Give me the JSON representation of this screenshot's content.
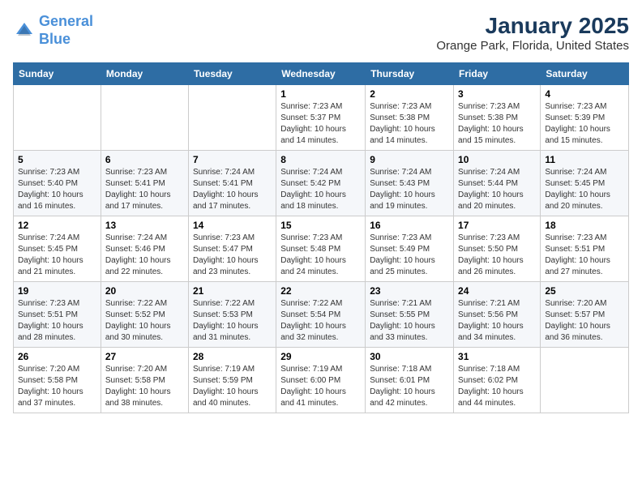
{
  "header": {
    "logo_line1": "General",
    "logo_line2": "Blue",
    "title": "January 2025",
    "subtitle": "Orange Park, Florida, United States"
  },
  "days_of_week": [
    "Sunday",
    "Monday",
    "Tuesday",
    "Wednesday",
    "Thursday",
    "Friday",
    "Saturday"
  ],
  "weeks": [
    [
      {
        "day": "",
        "info": ""
      },
      {
        "day": "",
        "info": ""
      },
      {
        "day": "",
        "info": ""
      },
      {
        "day": "1",
        "info": "Sunrise: 7:23 AM\nSunset: 5:37 PM\nDaylight: 10 hours and 14 minutes."
      },
      {
        "day": "2",
        "info": "Sunrise: 7:23 AM\nSunset: 5:38 PM\nDaylight: 10 hours and 14 minutes."
      },
      {
        "day": "3",
        "info": "Sunrise: 7:23 AM\nSunset: 5:38 PM\nDaylight: 10 hours and 15 minutes."
      },
      {
        "day": "4",
        "info": "Sunrise: 7:23 AM\nSunset: 5:39 PM\nDaylight: 10 hours and 15 minutes."
      }
    ],
    [
      {
        "day": "5",
        "info": "Sunrise: 7:23 AM\nSunset: 5:40 PM\nDaylight: 10 hours and 16 minutes."
      },
      {
        "day": "6",
        "info": "Sunrise: 7:23 AM\nSunset: 5:41 PM\nDaylight: 10 hours and 17 minutes."
      },
      {
        "day": "7",
        "info": "Sunrise: 7:24 AM\nSunset: 5:41 PM\nDaylight: 10 hours and 17 minutes."
      },
      {
        "day": "8",
        "info": "Sunrise: 7:24 AM\nSunset: 5:42 PM\nDaylight: 10 hours and 18 minutes."
      },
      {
        "day": "9",
        "info": "Sunrise: 7:24 AM\nSunset: 5:43 PM\nDaylight: 10 hours and 19 minutes."
      },
      {
        "day": "10",
        "info": "Sunrise: 7:24 AM\nSunset: 5:44 PM\nDaylight: 10 hours and 20 minutes."
      },
      {
        "day": "11",
        "info": "Sunrise: 7:24 AM\nSunset: 5:45 PM\nDaylight: 10 hours and 20 minutes."
      }
    ],
    [
      {
        "day": "12",
        "info": "Sunrise: 7:24 AM\nSunset: 5:45 PM\nDaylight: 10 hours and 21 minutes."
      },
      {
        "day": "13",
        "info": "Sunrise: 7:24 AM\nSunset: 5:46 PM\nDaylight: 10 hours and 22 minutes."
      },
      {
        "day": "14",
        "info": "Sunrise: 7:23 AM\nSunset: 5:47 PM\nDaylight: 10 hours and 23 minutes."
      },
      {
        "day": "15",
        "info": "Sunrise: 7:23 AM\nSunset: 5:48 PM\nDaylight: 10 hours and 24 minutes."
      },
      {
        "day": "16",
        "info": "Sunrise: 7:23 AM\nSunset: 5:49 PM\nDaylight: 10 hours and 25 minutes."
      },
      {
        "day": "17",
        "info": "Sunrise: 7:23 AM\nSunset: 5:50 PM\nDaylight: 10 hours and 26 minutes."
      },
      {
        "day": "18",
        "info": "Sunrise: 7:23 AM\nSunset: 5:51 PM\nDaylight: 10 hours and 27 minutes."
      }
    ],
    [
      {
        "day": "19",
        "info": "Sunrise: 7:23 AM\nSunset: 5:51 PM\nDaylight: 10 hours and 28 minutes."
      },
      {
        "day": "20",
        "info": "Sunrise: 7:22 AM\nSunset: 5:52 PM\nDaylight: 10 hours and 30 minutes."
      },
      {
        "day": "21",
        "info": "Sunrise: 7:22 AM\nSunset: 5:53 PM\nDaylight: 10 hours and 31 minutes."
      },
      {
        "day": "22",
        "info": "Sunrise: 7:22 AM\nSunset: 5:54 PM\nDaylight: 10 hours and 32 minutes."
      },
      {
        "day": "23",
        "info": "Sunrise: 7:21 AM\nSunset: 5:55 PM\nDaylight: 10 hours and 33 minutes."
      },
      {
        "day": "24",
        "info": "Sunrise: 7:21 AM\nSunset: 5:56 PM\nDaylight: 10 hours and 34 minutes."
      },
      {
        "day": "25",
        "info": "Sunrise: 7:20 AM\nSunset: 5:57 PM\nDaylight: 10 hours and 36 minutes."
      }
    ],
    [
      {
        "day": "26",
        "info": "Sunrise: 7:20 AM\nSunset: 5:58 PM\nDaylight: 10 hours and 37 minutes."
      },
      {
        "day": "27",
        "info": "Sunrise: 7:20 AM\nSunset: 5:58 PM\nDaylight: 10 hours and 38 minutes."
      },
      {
        "day": "28",
        "info": "Sunrise: 7:19 AM\nSunset: 5:59 PM\nDaylight: 10 hours and 40 minutes."
      },
      {
        "day": "29",
        "info": "Sunrise: 7:19 AM\nSunset: 6:00 PM\nDaylight: 10 hours and 41 minutes."
      },
      {
        "day": "30",
        "info": "Sunrise: 7:18 AM\nSunset: 6:01 PM\nDaylight: 10 hours and 42 minutes."
      },
      {
        "day": "31",
        "info": "Sunrise: 7:18 AM\nSunset: 6:02 PM\nDaylight: 10 hours and 44 minutes."
      },
      {
        "day": "",
        "info": ""
      }
    ]
  ]
}
